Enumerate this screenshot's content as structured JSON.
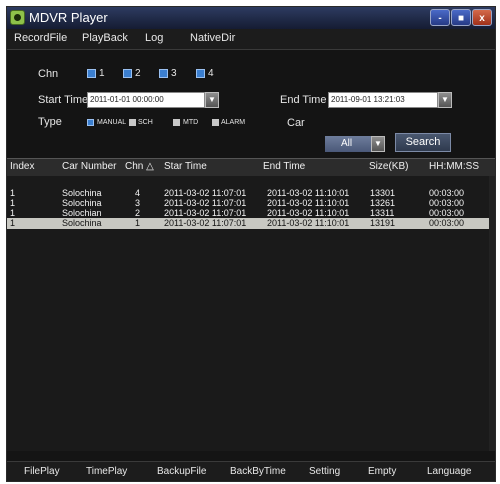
{
  "window": {
    "title": "MDVR Player"
  },
  "window_controls": {
    "minimize": "-",
    "maximize": "■",
    "close": "x"
  },
  "menu": [
    "RecordFile",
    "PlayBack",
    "Log",
    "NativeDir"
  ],
  "filter": {
    "chn_label": "Chn",
    "channels": [
      "1",
      "2",
      "3",
      "4"
    ],
    "start_time_label": "Start Time",
    "start_time_value": "2011-01-01 00:00:00",
    "end_time_label": "End Time",
    "end_time_value": "2011-09-01 13:21:03",
    "type_label": "Type",
    "types": [
      "MANUAL",
      "SCH",
      "MTD",
      "ALARM"
    ],
    "car_label": "Car",
    "car_value": "All",
    "search_label": "Search",
    "dropdown_glyph": "▼"
  },
  "table": {
    "columns": [
      "Index",
      "Car Number",
      "Chn △",
      "Star Time",
      "End Time",
      "Size(KB)",
      "HH:MM:SS"
    ],
    "rows": [
      {
        "index": "1",
        "car": "Solochina",
        "chn": "4",
        "start": "2011-03-02  11:07:01",
        "end": "2011-03-02  11:10:01",
        "size": "13301",
        "dur": "00:03:00",
        "selected": false
      },
      {
        "index": "1",
        "car": "Solochina",
        "chn": "3",
        "start": "2011-03-02  11:07:01",
        "end": "2011-03-02  11:10:01",
        "size": "13261",
        "dur": "00:03:00",
        "selected": false
      },
      {
        "index": "1",
        "car": "Solochian",
        "chn": "2",
        "start": "2011-03-02  11:07:01",
        "end": "2011-03-02  11:10:01",
        "size": "13311",
        "dur": "00:03:00",
        "selected": false
      },
      {
        "index": "1",
        "car": "Solochina",
        "chn": "1",
        "start": "2011-03-02  11:07:01",
        "end": "2011-03-02  11:10:01",
        "size": "13191",
        "dur": "00:03:00",
        "selected": true
      }
    ]
  },
  "bottom_bar": [
    "FilePlay",
    "TimePlay",
    "BackupFile",
    "BackByTime",
    "Setting",
    "Empty",
    "Language"
  ],
  "colors": {
    "window_bg": "#141414",
    "checkbox_blue": "#3b7fd0",
    "selected_row": "#c8c8c2"
  }
}
